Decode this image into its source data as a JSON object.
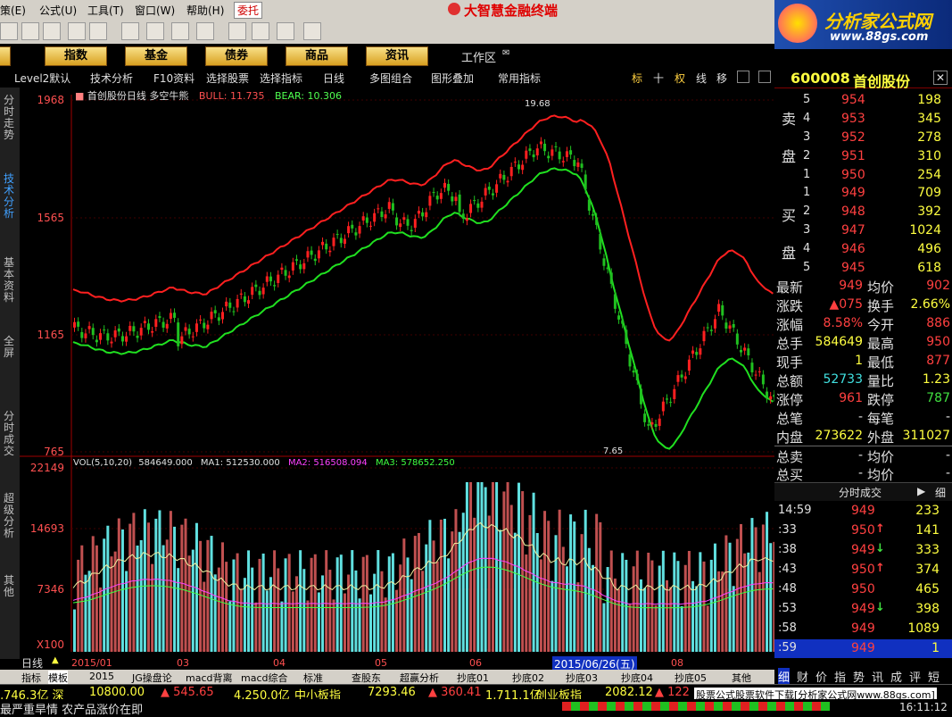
{
  "menu": {
    "items": [
      "策(E)",
      "公式(U)",
      "工具(T)",
      "窗口(W)",
      "帮助(H)",
      "委托"
    ],
    "window_title": "大智慧金融终端"
  },
  "logo": {
    "name": "分析家公式网",
    "url": "www.88gs.com"
  },
  "categories": [
    "股",
    "指数",
    "基金",
    "债券",
    "商品",
    "资讯"
  ],
  "workspace_label": "工作区",
  "toolrow": {
    "items": [
      "Level2默认",
      "技术分析",
      "F10资料",
      "选择股票",
      "选择指标",
      "日线",
      "多图组合",
      "图形叠加",
      "常用指标"
    ],
    "right_items": [
      "标",
      "十",
      "权",
      "线",
      "移"
    ]
  },
  "left_tabs": [
    "分时走势",
    "技术分析",
    "基本资料",
    "全屏",
    "分时成交",
    "超级分析",
    "其他"
  ],
  "chart_data": [
    {
      "type": "candlestick",
      "title": "首创股份日线 多空牛熊",
      "indicator_text": [
        "BULL: 11.735",
        "BEAR: 10.306"
      ],
      "y_ticks": [
        "1968",
        "1565",
        "1165",
        "765"
      ],
      "annotations": [
        "19.68",
        "7.65"
      ],
      "series": [
        {
          "name": "BULL"
        },
        {
          "name": "BEAR"
        }
      ]
    },
    {
      "type": "bar",
      "title": "VOL(5,10,20)",
      "header_values": [
        "584649.000",
        "MA1: 512530.000",
        "MA2: 516508.094",
        "MA3: 578652.250"
      ],
      "y_ticks": [
        "22149",
        "14693",
        "7346",
        "X100"
      ],
      "series": [
        {
          "name": "MA1"
        },
        {
          "name": "MA2"
        },
        {
          "name": "MA3"
        }
      ]
    }
  ],
  "date_axis": [
    "2015/01",
    "03",
    "04",
    "05",
    "06",
    "2015/06/26(五)",
    "08"
  ],
  "period_label": "日线",
  "bottom_tabs": [
    "指标",
    "模板",
    "2015",
    "JG操盘论",
    "macd背离",
    "macd综合",
    "标准",
    "查股东",
    "超赢分析",
    "抄底01",
    "抄底02",
    "抄底03",
    "抄底04",
    "抄底05",
    "其他"
  ],
  "quote": {
    "code": "600008",
    "name": "首创股份",
    "sell_label": [
      "卖",
      "盘"
    ],
    "buy_label": [
      "买",
      "盘"
    ],
    "sell": [
      {
        "level": "5",
        "price": "954",
        "vol": "198"
      },
      {
        "level": "4",
        "price": "953",
        "vol": "345"
      },
      {
        "level": "3",
        "price": "952",
        "vol": "278"
      },
      {
        "level": "2",
        "price": "951",
        "vol": "310"
      },
      {
        "level": "1",
        "price": "950",
        "vol": "254"
      }
    ],
    "buy": [
      {
        "level": "1",
        "price": "949",
        "vol": "709"
      },
      {
        "level": "2",
        "price": "948",
        "vol": "392"
      },
      {
        "level": "3",
        "price": "947",
        "vol": "1024"
      },
      {
        "level": "4",
        "price": "946",
        "vol": "496"
      },
      {
        "level": "5",
        "price": "945",
        "vol": "618"
      }
    ],
    "stats": [
      {
        "l1": "最新",
        "v1": "949",
        "l2": "均价",
        "v2": "902"
      },
      {
        "l1": "涨跌",
        "v1": "▲075",
        "l2": "换手",
        "v2": "2.66%"
      },
      {
        "l1": "涨幅",
        "v1": "8.58%",
        "l2": "今开",
        "v2": "886"
      },
      {
        "l1": "总手",
        "v1": "584649",
        "l2": "最高",
        "v2": "950"
      },
      {
        "l1": "现手",
        "v1": "1",
        "l2": "最低",
        "v2": "877"
      },
      {
        "l1": "总额",
        "v1": "52733",
        "l2": "量比",
        "v2": "1.23"
      },
      {
        "l1": "涨停",
        "v1": "961",
        "l2": "跌停",
        "v2": "787"
      },
      {
        "l1": "总笔",
        "v1": "-",
        "l2": "每笔",
        "v2": "-"
      },
      {
        "l1": "内盘",
        "v1": "273622",
        "l2": "外盘",
        "v2": "311027"
      },
      {
        "l1": "总卖",
        "v1": "-",
        "l2": "均价",
        "v2": "-"
      },
      {
        "l1": "总买",
        "v1": "-",
        "l2": "均价",
        "v2": "-"
      }
    ],
    "ticks_title": "分时成交",
    "ticks_btn": "细",
    "ticks": [
      {
        "t": "14:59",
        "p": "949",
        "a": "",
        "v": "233"
      },
      {
        "t": ":33",
        "p": "950",
        "a": "↑",
        "v": "141"
      },
      {
        "t": ":38",
        "p": "949",
        "a": "↓",
        "v": "333"
      },
      {
        "t": ":43",
        "p": "950",
        "a": "↑",
        "v": "374"
      },
      {
        "t": ":48",
        "p": "950",
        "a": "",
        "v": "465"
      },
      {
        "t": ":53",
        "p": "949",
        "a": "↓",
        "v": "398"
      },
      {
        "t": ":58",
        "p": "949",
        "a": "",
        "v": "1089"
      },
      {
        "t": ":59",
        "p": "949",
        "a": "",
        "v": "1"
      }
    ],
    "bottom_icons": [
      "细",
      "财",
      "价",
      "指",
      "势",
      "讯",
      "成",
      "评",
      "短"
    ]
  },
  "status": {
    "items": [
      {
        "text": ",746.3亿 深",
        "cls": "yel"
      },
      {
        "text": "10800.00",
        "cls": "yel"
      },
      {
        "text": "▲ 545.65",
        "cls": "red"
      },
      {
        "text": "4,250.0亿",
        "cls": "yel"
      },
      {
        "text": "中小板指",
        "cls": "yel"
      },
      {
        "text": "7293.46",
        "cls": "yel"
      },
      {
        "text": "▲ 360.41",
        "cls": "red"
      },
      {
        "text": "1,711.1亿",
        "cls": "yel"
      },
      {
        "text": "创业板指",
        "cls": "yel"
      },
      {
        "text": "2082.12",
        "cls": "yel"
      },
      {
        "text": "▲ 122",
        "cls": "red"
      }
    ],
    "ad": "股票公式股票软件下载[分析家公式网www.88gs.com]",
    "news": "最严重旱情 农产品涨价在即",
    "clock": "16:11:12"
  }
}
